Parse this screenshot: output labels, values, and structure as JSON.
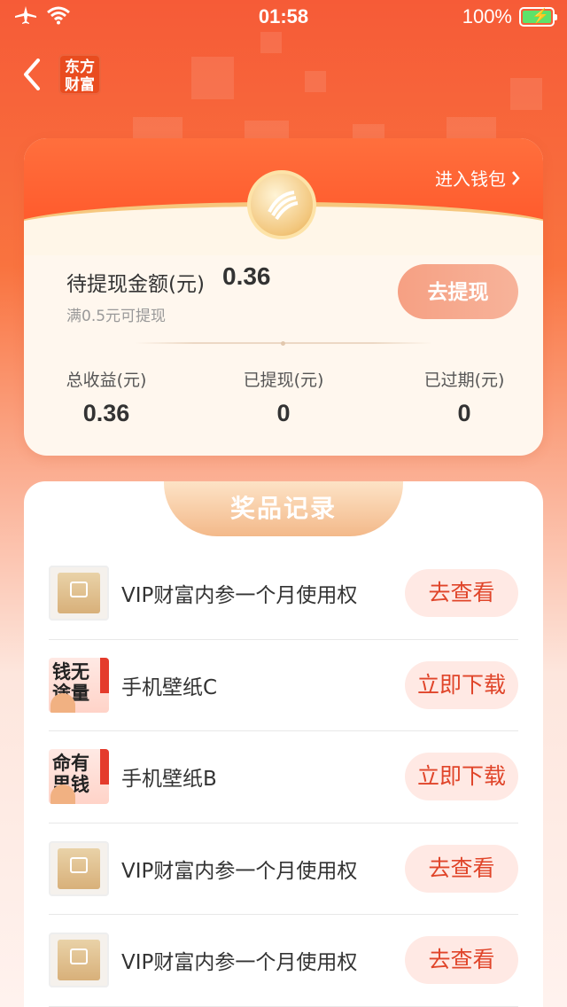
{
  "status_bar": {
    "time": "01:58",
    "battery": "100%"
  },
  "nav": {
    "logo_line1": "东方",
    "logo_line2": "财富"
  },
  "wallet": {
    "link_label": "进入钱包",
    "pending_label": "待提现金额(元)",
    "pending_value": "0.36",
    "min_hint": "满0.5元可提现",
    "withdraw_label": "去提现",
    "stats": [
      {
        "label": "总收益(元)",
        "value": "0.36"
      },
      {
        "label": "已提现(元)",
        "value": "0"
      },
      {
        "label": "已过期(元)",
        "value": "0"
      }
    ]
  },
  "prizes": {
    "title": "奖品记录",
    "items": [
      {
        "name": "VIP财富内参一个月使用权",
        "action": "去查看",
        "thumb": "vip-card-icon"
      },
      {
        "name": "手机壁纸C",
        "action": "立即下载",
        "thumb": "wallpaper-c",
        "thumb_text": "钱无\n途量"
      },
      {
        "name": "手机壁纸B",
        "action": "立即下载",
        "thumb": "wallpaper-b",
        "thumb_text": "命有\n里钱"
      },
      {
        "name": "VIP财富内参一个月使用权",
        "action": "去查看",
        "thumb": "vip-card-icon"
      },
      {
        "name": "VIP财富内参一个月使用权",
        "action": "去查看",
        "thumb": "vip-card-icon"
      }
    ]
  }
}
